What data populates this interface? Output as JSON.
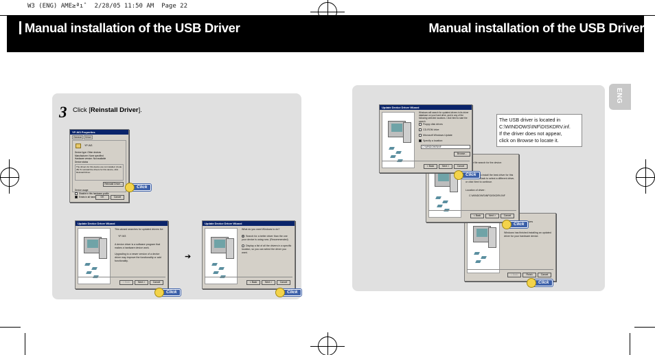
{
  "print_header": "W3 (ENG) AME≥ªıˆ  2/28/05 11:50 AM  Page 22",
  "left_title": "Manual installation of the USB Driver",
  "right_title": "Manual installation of the USB Driver",
  "side_tab": "ENG",
  "step": {
    "number": "3",
    "prefix": "Click [",
    "emphasis": "Reinstall Driver",
    "suffix": "]."
  },
  "callout": {
    "lines": [
      "The USB driver is located in",
      "C:\\WINDOWS\\INF\\DISKDRV.inf.",
      "If the driver does not appear,",
      "click on Browse to locate it."
    ]
  },
  "click_label": "Click",
  "dialogs": {
    "properties": {
      "title": "YP-W3    Properties",
      "tabs": [
        "General",
        "Driver"
      ],
      "device_name": "YP-W3",
      "rows": [
        "Device type:  Other devices",
        "Manufacturer:  None specified",
        "Hardware version:  Not available"
      ],
      "status_label": "Device status",
      "status_text": "The drivers for this device are not installed. (Code 28) To reinstall the drivers for this device, click Reinstall Driver.",
      "button": "Reinstall Driver...",
      "usage_label": "Device usage:",
      "usage_options": [
        "Disable in this hardware profile",
        "Exists in all hardware profiles"
      ],
      "ok": "OK",
      "cancel": "Cancel"
    },
    "wizard_welcome": {
      "title": "Update Device Driver Wizard",
      "line1": "This wizard searches for updated drivers for:",
      "device": "YP-W3",
      "line2": "A device driver is a software program that makes a hardware device work.",
      "line3": "Upgrading to a newer version of a device driver may improve the functionality or add functionality.",
      "back": "< Back",
      "next": "Next >",
      "cancel": "Cancel"
    },
    "wizard_choice": {
      "title": "Update Device Driver Wizard",
      "question": "What do you want Windows to do?",
      "option1": "Search for a better driver than the one your device is using now. (Recommended)",
      "option2": "Display a list of all the drivers in a specific location, so you can select the driver you want.",
      "back": "< Back",
      "next": "Next >",
      "cancel": "Cancel"
    },
    "wizard_locations": {
      "title": "Update Device Driver Wizard",
      "intro": "Windows will search for updated drivers in its driver database on your hard drive, and in any of the following selected locations. Click Next to start the search.",
      "options": [
        "Floppy disk drives",
        "CD-ROM drive",
        "Microsoft Windows Update",
        "Specify a location:"
      ],
      "path": "C:\\WINDOWS\\INF",
      "browse": "Browse...",
      "back": "< Back",
      "next": "Next >",
      "cancel": "Cancel"
    },
    "wizard_found": {
      "line1": "...driver file search for the device:",
      "line2": "...now ready to install the best driver for this device. Click Back to select a different driver, or click Next to continue.",
      "location_label": "Location of driver:",
      "location": "C:\\WINDOWS\\INF\\DISKDRV.INF",
      "back": "< Back",
      "next": "Next >",
      "cancel": "Cancel"
    },
    "wizard_finish": {
      "device": "...Drives",
      "line1": "Windows has finished installing an updated driver for your hardware device.",
      "back": "< Back",
      "finish": "Finish",
      "cancel": "Cancel"
    }
  }
}
